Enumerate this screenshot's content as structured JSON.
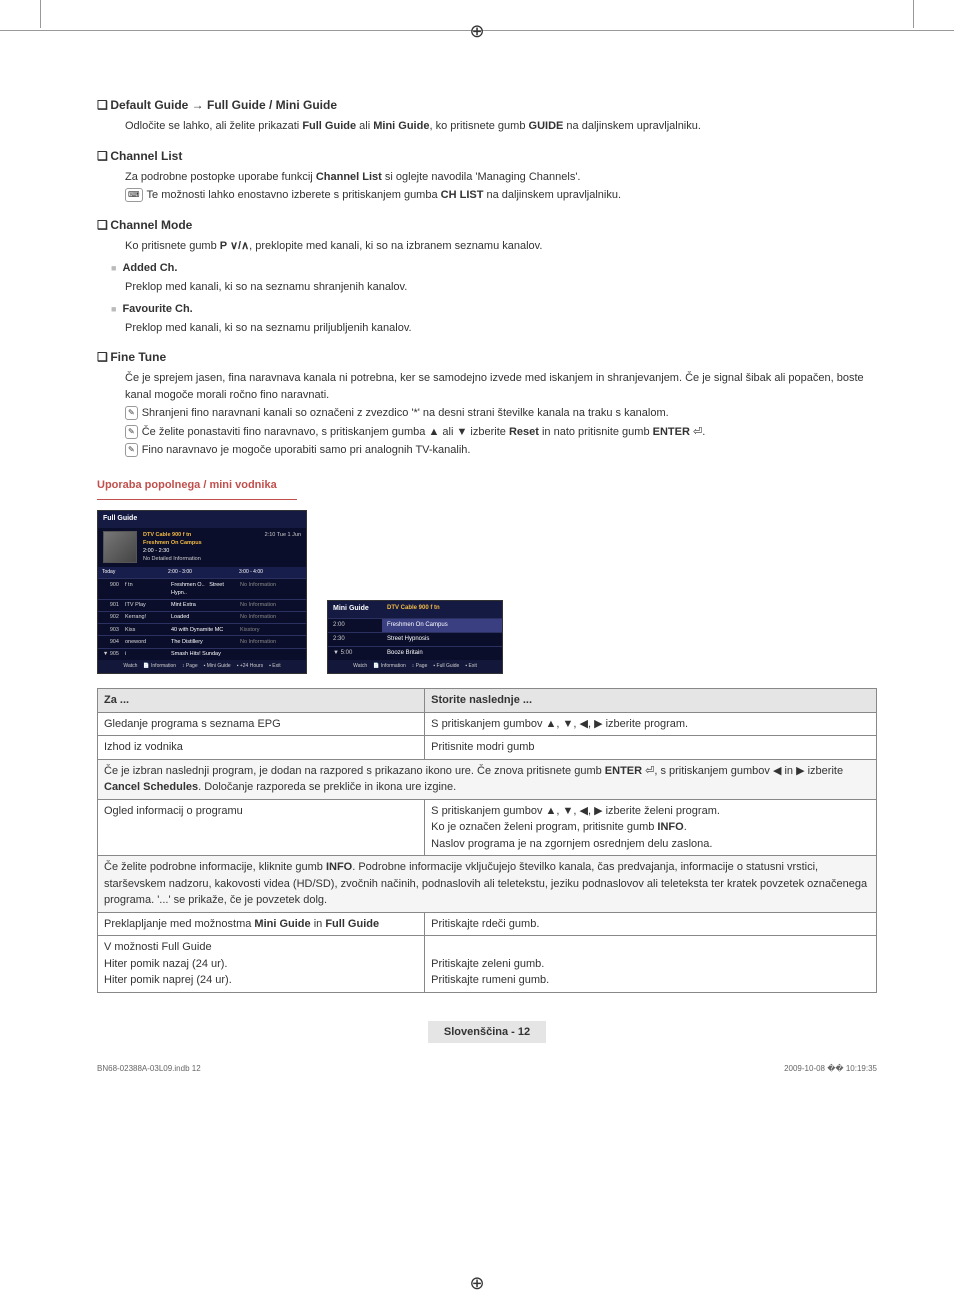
{
  "sections": {
    "default_guide": {
      "title": "Default Guide → Full Guide / Mini Guide",
      "body": "Odločite se lahko, ali želite prikazati Full Guide ali Mini Guide, ko pritisnete gumb GUIDE na daljinskem upravljalniku."
    },
    "channel_list": {
      "title": "Channel List",
      "line1": "Za podrobne postopke uporabe funkcij Channel List si oglejte navodila 'Managing Channels'.",
      "line2": "Te možnosti lahko enostavno izberete s pritiskanjem gumba CH LIST na daljinskem upravljalniku."
    },
    "channel_mode": {
      "title": "Channel Mode",
      "body": "Ko pritisnete gumb P ∨/∧, preklopite med kanali, ki so na izbranem seznamu kanalov.",
      "added": {
        "title": "Added Ch.",
        "body": "Preklop med kanali, ki so na seznamu shranjenih kanalov."
      },
      "fav": {
        "title": "Favourite Ch.",
        "body": "Preklop med kanali, ki so na seznamu priljubljenih kanalov."
      }
    },
    "fine_tune": {
      "title": "Fine Tune",
      "body": "Če je sprejem jasen, fina naravnava kanala ni potrebna, ker se samodejno izvede med iskanjem in shranjevanjem. Če je signal šibak ali popačen, boste kanal mogoče morali ročno fino naravnati.",
      "note1": "Shranjeni fino naravnani kanali so označeni z zvezdico '*' na desni strani številke kanala na traku s kanalom.",
      "note2": "Če želite ponastaviti fino naravnavo, s pritiskanjem gumba ▲ ali ▼ izberite Reset in nato pritisnite gumb ENTER ⏎.",
      "note3": "Fino naravnavo je mogoče uporabiti samo pri analognih TV-kanalih."
    }
  },
  "guide_heading": "Uporaba popolnega / mini vodnika",
  "full_guide": {
    "title": "Full Guide",
    "channel_header": "DTV Cable 900 f tn",
    "program": "Freshmen On Campus",
    "time": "2:00 - 2:30",
    "detail": "No Detailed Information",
    "date_col": "2:10 Tue 1 Jun",
    "col_today": "Today",
    "col_t1": "2:00 - 3:00",
    "col_t2": "3:00 - 4:00",
    "rows": [
      {
        "num": "900",
        "ch": "f tn",
        "p1": "Freshmen O..",
        "p1b": "Street Hypn..",
        "p2": "No Information"
      },
      {
        "num": "901",
        "ch": "ITV Play",
        "p1": "Mint Extra",
        "p1b": "",
        "p2": "No Information"
      },
      {
        "num": "902",
        "ch": "Kerrang!",
        "p1": "Loaded",
        "p1b": "",
        "p2": "No Information"
      },
      {
        "num": "903",
        "ch": "Kiss",
        "p1": "40 with Dynamite MC",
        "p1b": "",
        "p2": "Kisstory"
      },
      {
        "num": "904",
        "ch": "oneword",
        "p1": "The Distillery",
        "p1b": "",
        "p2": "No Information"
      },
      {
        "num": "▼ 905",
        "ch": "i",
        "p1": "Smash Hits! Sunday",
        "p1b": "",
        "p2": ""
      }
    ],
    "footer": {
      "watch": "Watch",
      "info": "Information",
      "page": "Page",
      "mini": "Mini Guide",
      "hours": "+24 Hours",
      "exit": "Exit"
    }
  },
  "mini_guide": {
    "title": "Mini Guide",
    "channel": "DTV Cable 900 f tn",
    "rows": [
      {
        "time": "2:00",
        "prog": "Freshmen On Campus",
        "hl": true
      },
      {
        "time": "2:30",
        "prog": "Street Hypnosis",
        "hl": false
      },
      {
        "time": "▼ 5:00",
        "prog": "Booze Britain",
        "hl": false
      }
    ],
    "footer": {
      "watch": "Watch",
      "info": "Information",
      "page": "Page",
      "full": "Full Guide",
      "exit": "Exit"
    }
  },
  "table": {
    "h1": "Za ...",
    "h2": "Storite naslednje ...",
    "r1a": "Gledanje programa s seznama EPG",
    "r1b": "S pritiskanjem gumbov ▲, ▼, ◀, ▶ izberite program.",
    "r2a": "Izhod iz vodnika",
    "r2b": "Pritisnite modri gumb",
    "m1": "Če je izbran naslednji program, je dodan na razpored s prikazano ikono ure. Če znova pritisnete gumb ENTER ⏎, s pritiskanjem gumbov ◀ in ▶ izberite Cancel Schedules. Določanje razporeda se prekliče in ikona ure izgine.",
    "r3a": "Ogled informacij o programu",
    "r3b1": "S pritiskanjem gumbov ▲, ▼, ◀, ▶ izberite želeni program.",
    "r3b2": "Ko je označen želeni program, pritisnite gumb INFO.",
    "r3b3": "Naslov programa je na zgornjem osrednjem delu zaslona.",
    "m2": "Če želite podrobne informacije, kliknite gumb INFO. Podrobne informacije vključujejo številko kanala, čas predvajanja, informacije o statusni vrstici, starševskem nadzoru, kakovosti videa (HD/SD), zvočnih načinih, podnaslovih ali teletekstu, jeziku podnaslovov ali teleteksta ter kratek povzetek označenega programa. '...' se prikaže, če je povzetek dolg.",
    "r4a": "Preklapljanje med možnostma Mini Guide in Full Guide",
    "r4b": "Pritiskajte rdeči gumb.",
    "r5a1": "V možnosti Full Guide",
    "r5a2": "Hiter pomik nazaj (24 ur).",
    "r5a3": "Hiter pomik naprej (24 ur).",
    "r5b2": "Pritiskajte zeleni gumb.",
    "r5b3": "Pritiskajte rumeni gumb."
  },
  "page_footer": "Slovenščina - 12",
  "print_footer": {
    "left": "BN68-02388A-03L09.indb   12",
    "right": "2009-10-08   �� 10:19:35"
  }
}
